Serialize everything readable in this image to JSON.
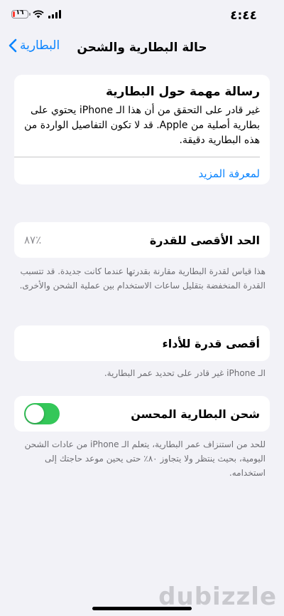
{
  "status_bar": {
    "time": "٤:٤٤",
    "battery_level": "١٦",
    "battery_fraction": 0.16
  },
  "nav": {
    "back_label": "البطارية",
    "title": "حالة البطارية والشحن"
  },
  "notice": {
    "title": "رسالة مهمة حول البطارية",
    "body": "غير قادر على التحقق من أن هذا الـ iPhone يحتوي على بطارية أصلية من Apple. قد لا تكون التفاصيل الواردة من هذه البطارية دقيقة.",
    "link": "لمعرفة المزيد"
  },
  "max_capacity": {
    "label": "الحد الأقصى للقدرة",
    "value": "٪٨٧",
    "footnote": "هذا قياس لقدرة البطارية مقارنة بقدرتها عندما كانت جديدة. قد تتسبب القدرة المنخفضة بتقليل ساعات الاستخدام بين عملية الشحن والأخرى."
  },
  "peak_performance": {
    "label": "أقصى قدرة للأداء",
    "footnote": "الـ iPhone غير قادر على تحديد عمر البطارية."
  },
  "optimized_charging": {
    "label": "شحن البطارية المحسن",
    "enabled": true,
    "footnote": "للحد من استنزاف عمر البطارية، يتعلم الـ iPhone من عادات الشحن اليومية، بحيث ينتظر ولا يتجاوز ٨٠٪ حتى يحين موعد حاجتك إلى استخدامه."
  },
  "watermark": "dubizzle",
  "colors": {
    "accent": "#0a84ff",
    "toggle_on": "#34c759",
    "battery_low": "#ff3b30",
    "background": "#f2f2f7"
  }
}
